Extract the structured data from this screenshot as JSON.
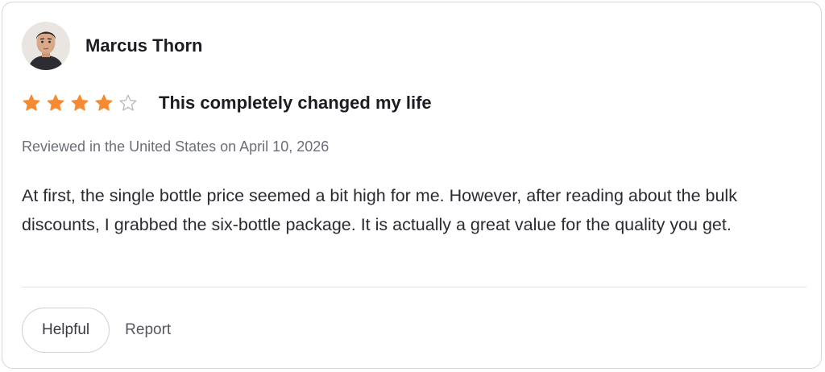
{
  "review": {
    "author": "Marcus Thorn",
    "rating": 4,
    "max_rating": 5,
    "title": "This completely changed my life",
    "meta": "Reviewed in the United States on April 10, 2026",
    "body": "At first, the single bottle price seemed a bit high for me. However, after reading about the bulk discounts, I grabbed the six-bottle package. It is actually a great value for the quality you get."
  },
  "actions": {
    "helpful_label": "Helpful",
    "report_label": "Report"
  },
  "colors": {
    "star_filled": "#f58a32",
    "star_empty": "#b8b8bd",
    "text_primary": "#1c1d22",
    "text_muted": "#6b6e76"
  },
  "icons": {
    "avatar": "user-avatar",
    "star": "star-icon"
  }
}
